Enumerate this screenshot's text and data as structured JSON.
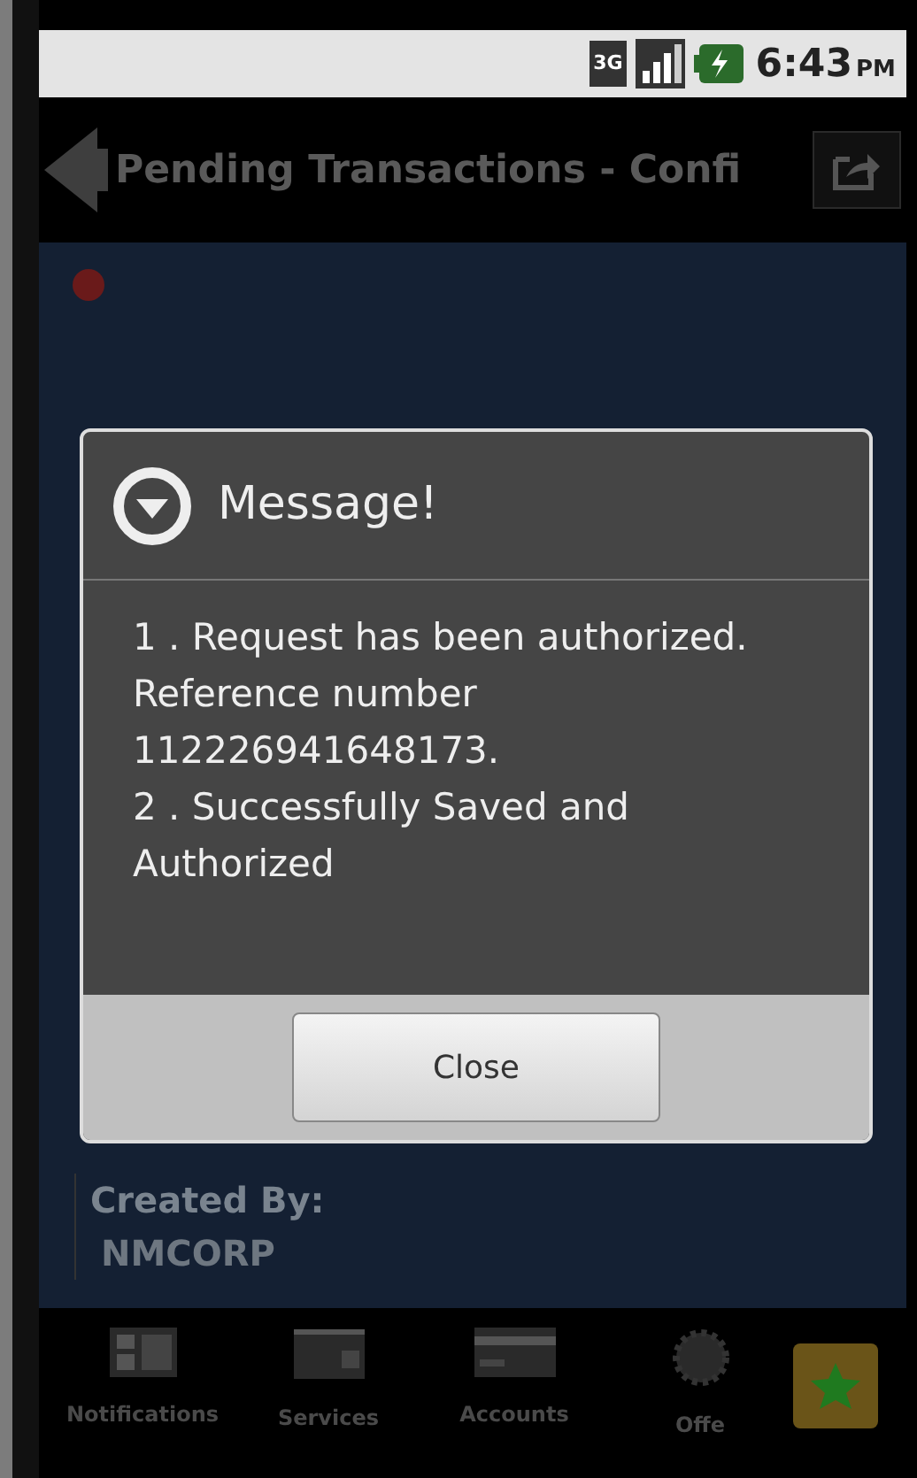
{
  "status_bar": {
    "network": "3G",
    "time": "6:43",
    "ampm": "PM"
  },
  "title_bar": {
    "title": "Pending Transactions - Confi"
  },
  "background": {
    "fields": [
      {
        "label": "Created By:",
        "value": "NMCORP"
      }
    ]
  },
  "dialog": {
    "title": "Message!",
    "lines": [
      "1 . Request has been authorized. Reference number 112226941648173.",
      "2 . Successfully Saved and Authorized"
    ],
    "button": "Close"
  },
  "bottom_nav": [
    {
      "label": "Notifications",
      "kind": "card"
    },
    {
      "label": "Services",
      "kind": "wallet"
    },
    {
      "label": "Accounts",
      "kind": "creditcard"
    },
    {
      "label": "Offe",
      "kind": "gear"
    },
    {
      "kind": "star"
    }
  ]
}
